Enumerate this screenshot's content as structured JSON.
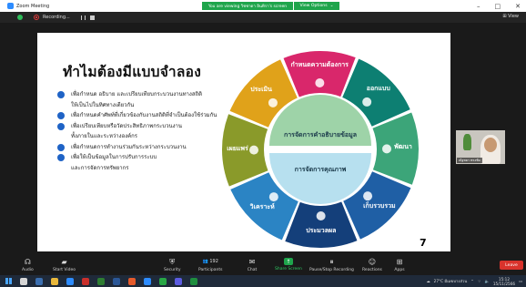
{
  "window": {
    "app_title": "Zoom Meeting",
    "banner": "You are viewing วิชชาดา อินทิรา's screen",
    "view_options": "View Options",
    "minimize": "–",
    "maximize": "□",
    "close": "✕"
  },
  "recording": {
    "status": "Recording...",
    "view_label": "View"
  },
  "slide": {
    "title": "ทำไมต้องมีแบบจำลอง",
    "bullets": [
      {
        "line1": "เพื่อกำหนด อธิบาย และเปรียบเทียบกระบวนงานทางสถิติ",
        "line2": "ให้เป็นไปในทิศทางเดียวกัน"
      },
      {
        "line1": "เพื่อกำหนดคำศัพท์ที่เกี่ยวข้องกับงานสถิติที่จำเป็นต้องใช้ร่วมกัน",
        "line2": ""
      },
      {
        "line1": "เพื่อเปรียบเทียบหรือวัดประสิทธิภาพกระบวนงาน",
        "line2": "ทั้งภายในและระหว่างองค์กร"
      },
      {
        "line1": "เพื่อกำหนดการทำงานร่วมกันระหว่างกระบวนงาน",
        "line2": ""
      },
      {
        "line1": "เพื่อให้เป็นข้อมูลในการปรับการระบบ",
        "line2": "และการจัดการทรัพยากร"
      }
    ],
    "page_number": "7",
    "cycle": {
      "segments": [
        {
          "label": "กำหนดความต้องการ",
          "color": "#d9276b"
        },
        {
          "label": "ออกแบบ",
          "color": "#0d7f72"
        },
        {
          "label": "พัฒนา",
          "color": "#3ca579"
        },
        {
          "label": "เก็บรวบรวม",
          "color": "#1f5fa5"
        },
        {
          "label": "ประมวลผล",
          "color": "#143f7a"
        },
        {
          "label": "วิเคราะห์",
          "color": "#2b84c4"
        },
        {
          "label": "เผยแพร่",
          "color": "#8a9a2a"
        },
        {
          "label": "ประเมิน",
          "color": "#e0a21a"
        }
      ],
      "inner_top": "การจัดการคำอธิบายข้อมูล",
      "inner_bottom": "การจัดการคุณภาพ",
      "inner_top_color": "#9ed3a8",
      "inner_bottom_color": "#b7e0ef"
    }
  },
  "participant": {
    "name": "ณัฐชยา ทรงชัย"
  },
  "toolbar": {
    "audio": "Audio",
    "video": "Start Video",
    "security": "Security",
    "participants": "Participants",
    "participants_count": "192",
    "chat": "Chat",
    "share": "Share Screen",
    "record": "Pause/Stop Recording",
    "reactions": "Reactions",
    "apps": "Apps",
    "leave": "Leave"
  },
  "taskbar": {
    "weather": "27°C มีเมฆบางส่วน",
    "time": "15:12",
    "date": "15/11/2566"
  }
}
